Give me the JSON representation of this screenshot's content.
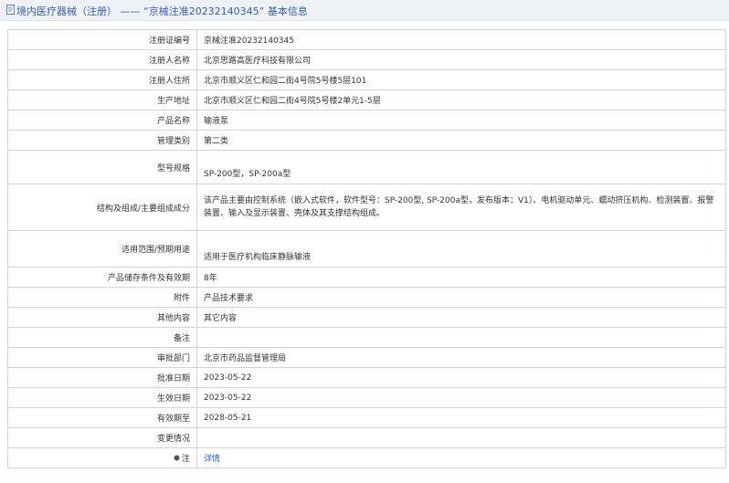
{
  "header": {
    "title": "境内医疗器械（注册） —— “京械注准20232140345” 基本信息"
  },
  "rows": [
    {
      "label": "注册证编号",
      "value": "京械注准20232140345"
    },
    {
      "label": "注册人名称",
      "value": "北京思路高医疗科技有限公司"
    },
    {
      "label": "注册人住所",
      "value": "北京市顺义区仁和园二街4号院5号楼5层101"
    },
    {
      "label": "生产地址",
      "value": "北京市顺义区仁和园二街4号院5号楼2单元1-5层"
    },
    {
      "label": "产品名称",
      "value": "输液泵"
    },
    {
      "label": "管理类别",
      "value": "第二类"
    },
    {
      "label": "型号规格",
      "value": "SP-200型，SP-200a型"
    },
    {
      "label": "结构及组成/主要组成成分",
      "value": "该产品主要由控制系统（嵌入式软件，软件型号：SP-200型, SP-200a型，发布版本：V1）、电机驱动单元、蠕动挤压机构、检测装置、报警装置、输入及显示装置、壳体及其支撑结构组成。"
    },
    {
      "label": "适用范围/预期用途",
      "value": "适用于医疗机构临床静脉输液"
    },
    {
      "label": "产品储存条件及有效期",
      "value": "8年"
    },
    {
      "label": "附件",
      "value": "产品技术要求"
    },
    {
      "label": "其他内容",
      "value": "其它内容"
    },
    {
      "label": "备注",
      "value": ""
    },
    {
      "label": "审批部门",
      "value": "北京市药品监督管理局"
    },
    {
      "label": "批准日期",
      "value": "2023-05-22"
    },
    {
      "label": "生效日期",
      "value": "2023-05-22"
    },
    {
      "label": "有效期至",
      "value": "2028-05-21"
    },
    {
      "label": "变更情况",
      "value": ""
    },
    {
      "label": "注",
      "value": "详情"
    }
  ],
  "colors": {
    "header_bg": "#eef1f6",
    "title": "#3a5ea6",
    "border": "#cfd3da",
    "link": "#2a62c9"
  },
  "icons": {
    "header": "document-icon",
    "note": "info-dot-icon"
  }
}
